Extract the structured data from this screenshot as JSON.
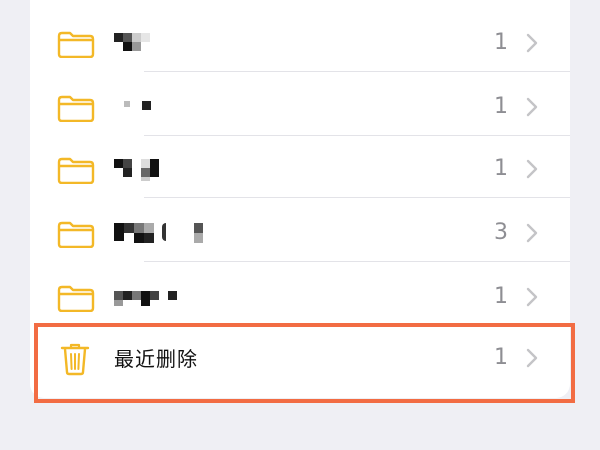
{
  "folders": [
    {
      "count": "1"
    },
    {
      "count": "1"
    },
    {
      "count": "1"
    },
    {
      "count": "3"
    },
    {
      "count": "1"
    }
  ],
  "recently_deleted": {
    "label": "最近删除",
    "count": "1"
  },
  "colors": {
    "folder_icon": "#f3b827",
    "count_text": "#8e8e93",
    "chevron": "#c4c4c7",
    "highlight_border": "#f26c43",
    "background": "#efeff4",
    "card": "#ffffff"
  },
  "icons": {
    "folder": "folder-icon",
    "trash": "trash-icon",
    "chevron": "chevron-right-icon"
  }
}
